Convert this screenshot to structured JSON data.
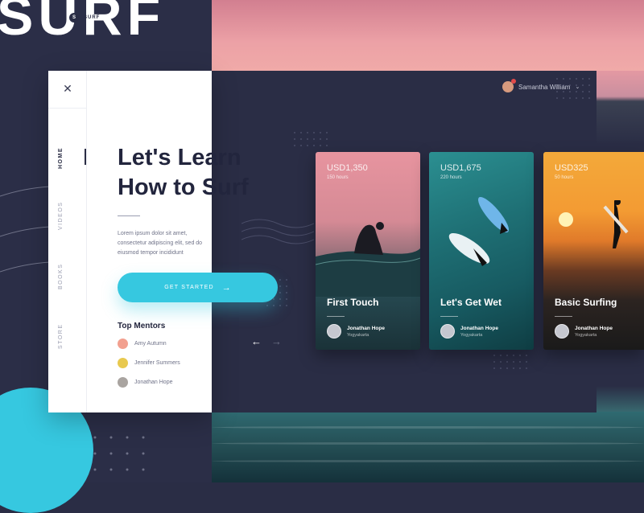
{
  "brand": {
    "big": "SURF",
    "logo_letter": "S",
    "logo_text": "SURF"
  },
  "user": {
    "name": "Samantha William"
  },
  "nav": {
    "items": [
      {
        "label": "HOME"
      },
      {
        "label": "VIDEOS"
      },
      {
        "label": "BOOKS"
      },
      {
        "label": "STORE"
      }
    ]
  },
  "hero": {
    "title_line1": "Let's Learn",
    "title_line2": "How to Surf",
    "description": "Lorem ipsum dolor sit amet, consectetur adipiscing elit, sed do eiusmod tempor incididunt",
    "cta": "GET STARTED"
  },
  "mentors": {
    "title": "Top Mentors",
    "items": [
      {
        "name": "Amy Autumn",
        "color": "#f2a08f"
      },
      {
        "name": "Jennifer Summers",
        "color": "#e8c94f"
      },
      {
        "name": "Jonathan Hope",
        "color": "#a9a4a0"
      }
    ]
  },
  "cards": [
    {
      "price": "USD1,350",
      "hours": "150 hours",
      "title": "First Touch",
      "author": "Jonathan Hope",
      "location": "Yogyakarta"
    },
    {
      "price": "USD1,675",
      "hours": "220 hours",
      "title": "Let's Get Wet",
      "author": "Jonathan Hope",
      "location": "Yogyakarta"
    },
    {
      "price": "USD325",
      "hours": "50 hours",
      "title": "Basic Surfing",
      "author": "Jonathan Hope",
      "location": "Yogyakarta"
    }
  ],
  "colors": {
    "accent": "#36c8e0",
    "dark": "#2a2d45"
  }
}
